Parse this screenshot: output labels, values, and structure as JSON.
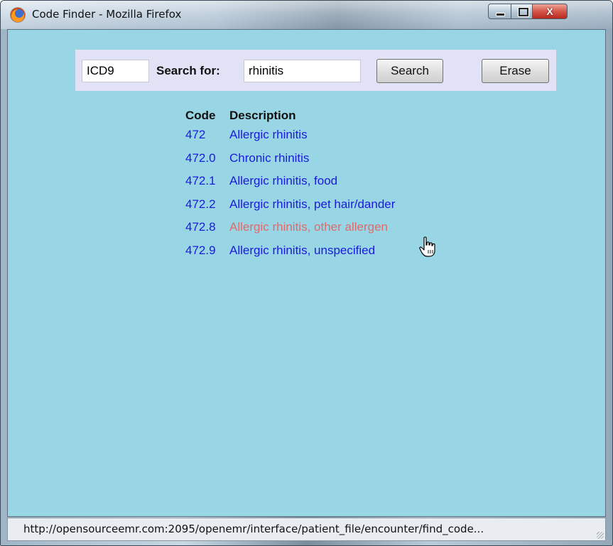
{
  "window": {
    "title": "Code Finder - Mozilla Firefox",
    "close_label": "X"
  },
  "search": {
    "code_type_value": "ICD9",
    "label": "Search for:",
    "query_value": "rhinitis",
    "search_button": "Search",
    "erase_button": "Erase"
  },
  "results": {
    "header_code": "Code",
    "header_description": "Description",
    "rows": [
      {
        "code": "472",
        "description": "Allergic rhinitis"
      },
      {
        "code": "472.0",
        "description": "Chronic rhinitis"
      },
      {
        "code": "472.1",
        "description": "Allergic rhinitis, food"
      },
      {
        "code": "472.2",
        "description": "Allergic rhinitis, pet hair/dander"
      },
      {
        "code": "472.8",
        "description": "Allergic rhinitis, other allergen"
      },
      {
        "code": "472.9",
        "description": "Allergic rhinitis, unspecified"
      }
    ]
  },
  "status": {
    "url": "http://opensourceemr.com:2095/openemr/interface/patient_file/encounter/find_code..."
  },
  "colors": {
    "page_background": "#98d6e6",
    "search_panel": "#e2e2f7",
    "link": "#1a1adb",
    "link_hover": "#e06a6a"
  }
}
